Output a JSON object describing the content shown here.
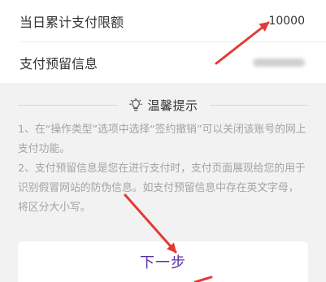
{
  "settings": {
    "daily_limit": {
      "label": "当日累计支付限额",
      "value": "10000"
    },
    "reserved_info": {
      "label": "支付预留信息"
    }
  },
  "tips": {
    "title": "温馨提示",
    "items": [
      "1、在“操作类型”选项中选择“签约撤销”可以关闭该账号的网上支付功能。",
      "2、支付预留信息是您在进行支付时，支付页面展现给您的用于识别假冒网站的防伪信息。如支付预留信息中存在英文字母，将区分大小写。"
    ]
  },
  "actions": {
    "next_label": "下一步"
  },
  "colors": {
    "accent": "#5a2ea6",
    "annotation_arrow": "#e53935"
  },
  "icons": {
    "tip_icon": "lightbulb-icon"
  }
}
